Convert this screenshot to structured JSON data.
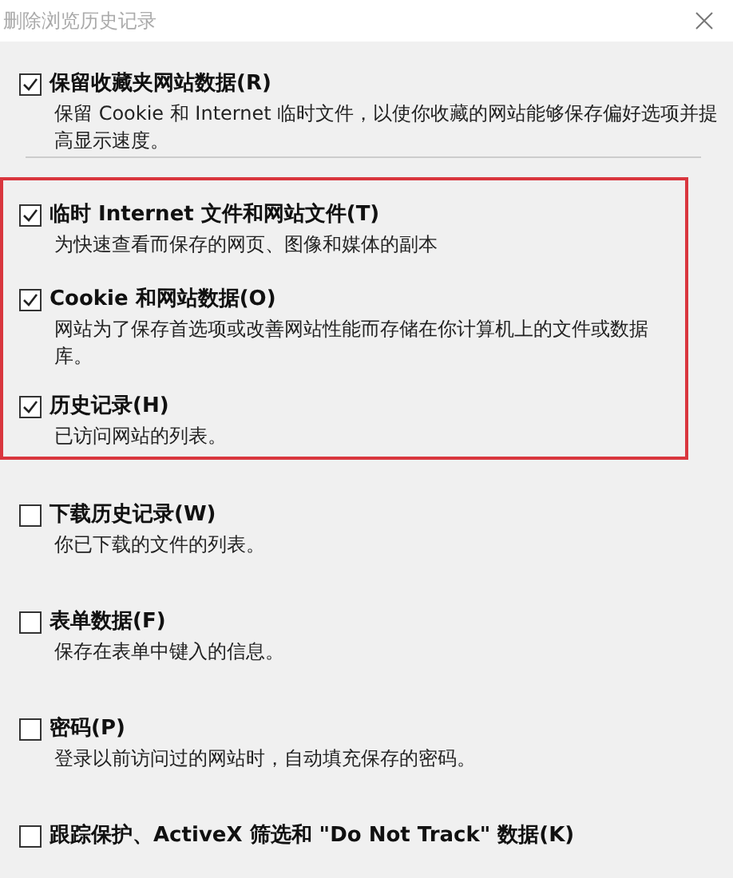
{
  "window": {
    "title": "删除浏览历史记录"
  },
  "options": [
    {
      "label": "保留收藏夹网站数据(R)",
      "description": "保留 Cookie 和 Internet 临时文件，以使你收藏的网站能够保存偏好选项并提高显示速度。",
      "checked": true,
      "highlighted": false
    },
    {
      "label": "临时 Internet 文件和网站文件(T)",
      "description": "为快速查看而保存的网页、图像和媒体的副本",
      "checked": true,
      "highlighted": true
    },
    {
      "label": "Cookie 和网站数据(O)",
      "description": "网站为了保存首选项或改善网站性能而存储在你计算机上的文件或数据库。",
      "checked": true,
      "highlighted": true
    },
    {
      "label": "历史记录(H)",
      "description": "已访问网站的列表。",
      "checked": true,
      "highlighted": true
    },
    {
      "label": "下载历史记录(W)",
      "description": "你已下载的文件的列表。",
      "checked": false,
      "highlighted": false
    },
    {
      "label": "表单数据(F)",
      "description": "保存在表单中键入的信息。",
      "checked": false,
      "highlighted": false
    },
    {
      "label": "密码(P)",
      "description": "登录以前访问过的网站时，自动填充保存的密码。",
      "checked": false,
      "highlighted": false
    },
    {
      "label": "跟踪保护、ActiveX 筛选和 \"Do Not Track\" 数据(K)",
      "checked": false,
      "highlighted": false
    }
  ]
}
